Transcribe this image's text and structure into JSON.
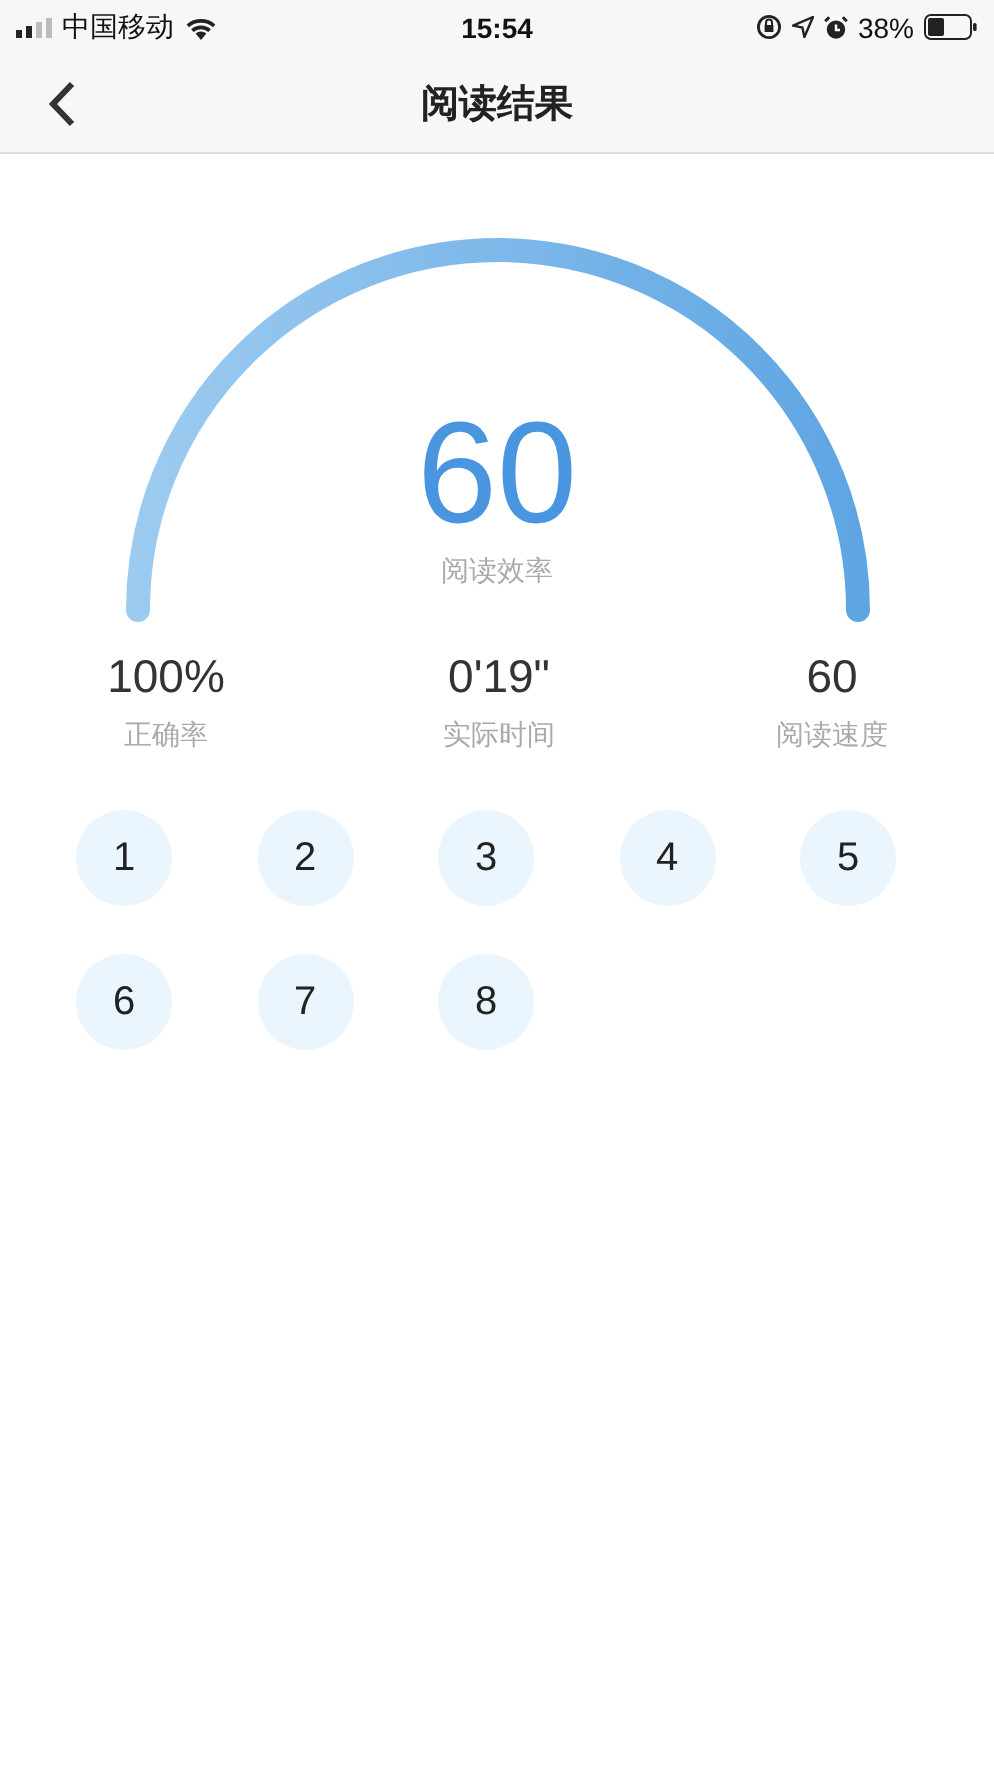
{
  "status_bar": {
    "carrier": "中国移动",
    "time": "15:54",
    "battery": "38%"
  },
  "nav": {
    "title": "阅读结果"
  },
  "gauge": {
    "value": "60",
    "label": "阅读效率"
  },
  "stats": [
    {
      "value": "100%",
      "label": "正确率"
    },
    {
      "value": "0'19\"",
      "label": "实际时间"
    },
    {
      "value": "60",
      "label": "阅读速度"
    }
  ],
  "questions": [
    "1",
    "2",
    "3",
    "4",
    "5",
    "6",
    "7",
    "8"
  ]
}
